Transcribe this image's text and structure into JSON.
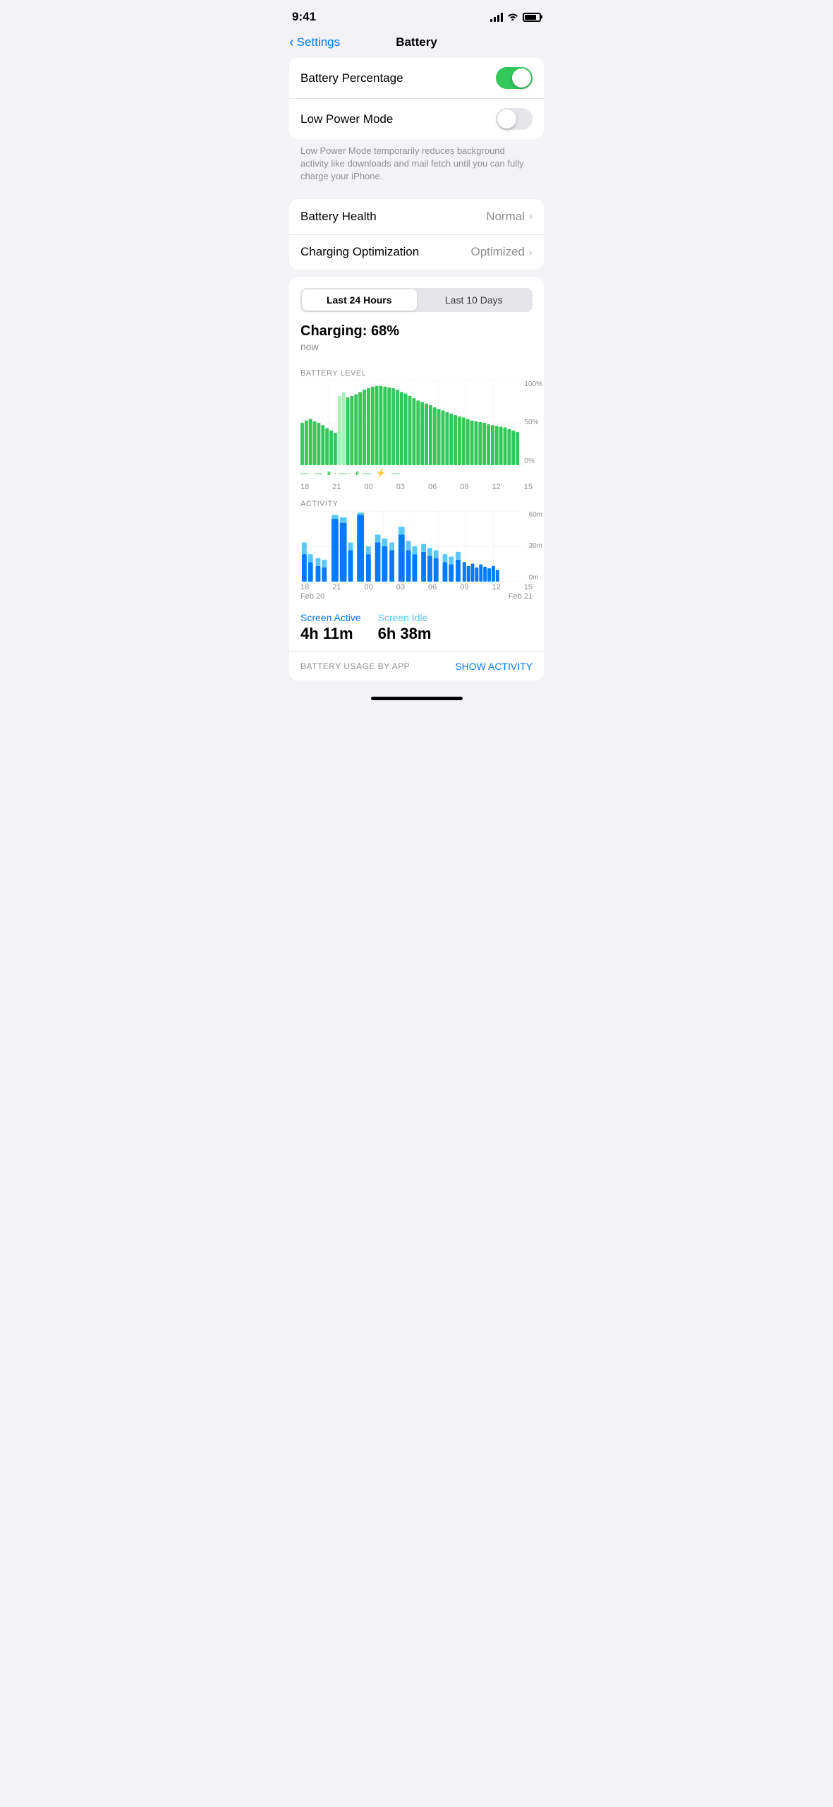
{
  "statusBar": {
    "time": "9:41"
  },
  "nav": {
    "backLabel": "Settings",
    "title": "Battery"
  },
  "settings": {
    "batteryPercentageLabel": "Battery Percentage",
    "batteryPercentageEnabled": true,
    "lowPowerModeLabel": "Low Power Mode",
    "lowPowerModeEnabled": false,
    "helperText": "Low Power Mode temporarily reduces background activity like downloads and mail fetch until you can fully charge your iPhone.",
    "batteryHealthLabel": "Battery Health",
    "batteryHealthValue": "Normal",
    "chargingOptimizationLabel": "Charging Optimization",
    "chargingOptimizationValue": "Optimized"
  },
  "chart": {
    "timeTabs": [
      "Last 24 Hours",
      "Last 10 Days"
    ],
    "activeTab": 0,
    "chargingLabel": "Charging: 68%",
    "chargingSubLabel": "now",
    "batteryLevelSectionLabel": "BATTERY LEVEL",
    "yLabels": [
      "100%",
      "50%",
      "0%"
    ],
    "activitySectionLabel": "ACTIVITY",
    "activityYLabels": [
      "60m",
      "30m",
      "0m"
    ],
    "xLabels": [
      "18",
      "21",
      "00",
      "03",
      "06",
      "09",
      "12",
      "15"
    ],
    "xLabelsActivity": [
      "18",
      "21",
      "00",
      "03",
      "06",
      "09",
      "12",
      "15"
    ],
    "dateLabelLeft": "Feb 20",
    "dateLabelRight": "Feb 21",
    "screenActiveLabel": "Screen Active",
    "screenActiveValue": "4h 11m",
    "screenIdleLabel": "Screen Idle",
    "screenIdleValue": "6h 38m",
    "usageByAppLabel": "BATTERY USAGE BY APP",
    "showActivityLabel": "SHOW ACTIVITY"
  }
}
